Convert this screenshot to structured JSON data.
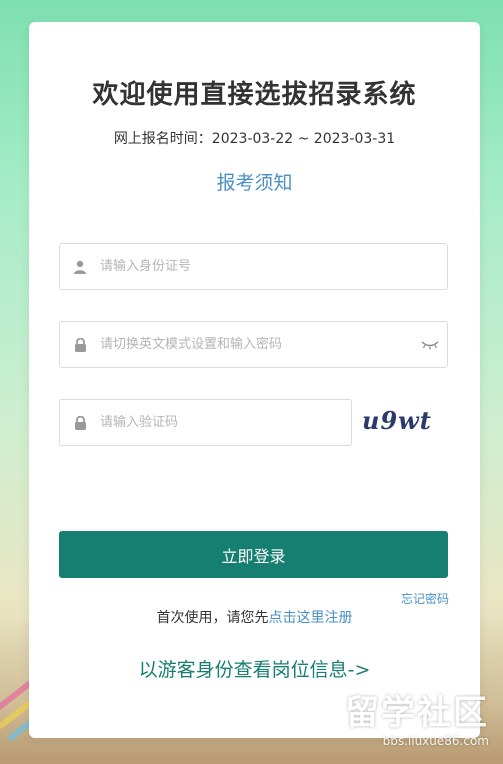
{
  "page": {
    "title": "欢迎使用直接选拔招录系统",
    "period": "网上报名时间：2023-03-22 ~ 2023-03-31",
    "notice_link": "报考须知"
  },
  "form": {
    "id_placeholder": "请输入身份证号",
    "password_placeholder": "请切换英文模式设置和输入密码",
    "captcha_placeholder": "请输入验证码",
    "captcha_text": "u9wt",
    "login_label": "立即登录",
    "forgot_label": "忘记密码"
  },
  "register": {
    "prefix": "首次使用，请您先",
    "link": "点击这里注册"
  },
  "guest_link": "以游客身份查看岗位信息->",
  "watermark": {
    "logo": "留学社区",
    "url": "bbs.liuxue86.com"
  },
  "colors": {
    "accent": "#167f71",
    "link": "#4a90c8"
  }
}
